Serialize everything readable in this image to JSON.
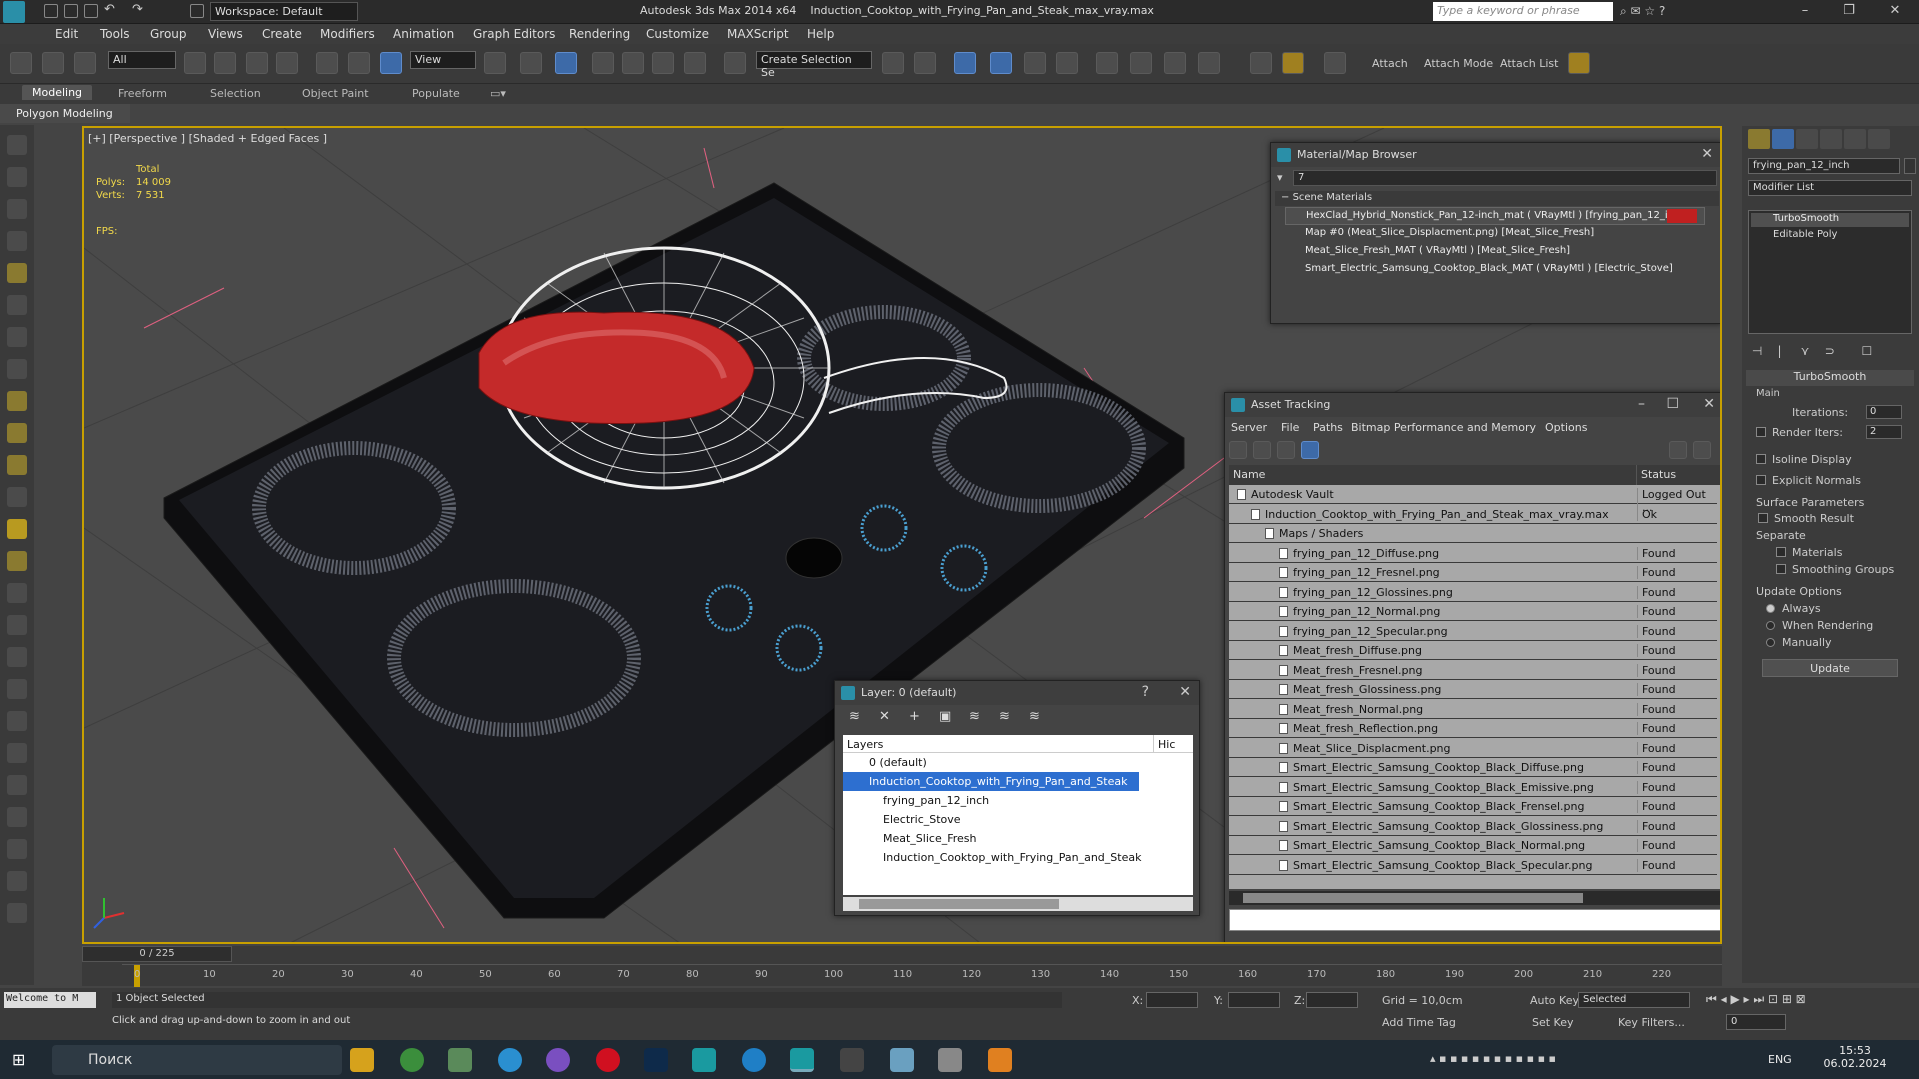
{
  "titlebar": {
    "workspace": "Workspace: Default",
    "app": "Autodesk 3ds Max  2014 x64",
    "file": "Induction_Cooktop_with_Frying_Pan_and_Steak_max_vray.max",
    "search_placeholder": "Type a keyword or phrase"
  },
  "menu": [
    "Edit",
    "Tools",
    "Group",
    "Views",
    "Create",
    "Modifiers",
    "Animation",
    "Graph Editors",
    "Rendering",
    "Customize",
    "MAXScript",
    "Help"
  ],
  "toolbar": {
    "filter": "All",
    "coord": "View",
    "selection_set": "Create Selection Se",
    "attach": "Attach",
    "attach_mode": "Attach Mode",
    "attach_list": "Attach List"
  },
  "ribbon": {
    "tabs": [
      "Modeling",
      "Freeform",
      "Selection",
      "Object Paint",
      "Populate"
    ],
    "sub": "Polygon Modeling"
  },
  "viewport": {
    "label": "[+] [Perspective ] [Shaded + Edged Faces ]",
    "total": "Total",
    "polys_label": "Polys:",
    "polys": "14 009",
    "verts_label": "Verts:",
    "verts": "7 531",
    "fps": "FPS:"
  },
  "material_browser": {
    "title": "Material/Map Browser",
    "filter": "7",
    "section": "Scene Materials",
    "items": [
      "HexClad_Hybrid_Nonstick_Pan_12-inch_mat ( VRayMtl ) [frying_pan_12_in...",
      "Map #0 (Meat_Slice_Displacment.png) [Meat_Slice_Fresh]",
      "Meat_Slice_Fresh_MAT ( VRayMtl ) [Meat_Slice_Fresh]",
      "Smart_Electric_Samsung_Cooktop_Black_MAT ( VRayMtl ) [Electric_Stove]"
    ]
  },
  "asset_tracking": {
    "title": "Asset Tracking",
    "menu": [
      "Server",
      "File",
      "Paths",
      "Bitmap Performance and Memory",
      "Options"
    ],
    "col_name": "Name",
    "col_status": "Status",
    "rows": [
      {
        "name": "Autodesk Vault",
        "status": "Logged Out ...",
        "indent": 0
      },
      {
        "name": "Induction_Cooktop_with_Frying_Pan_and_Steak_max_vray.max",
        "status": "Ok",
        "indent": 1
      },
      {
        "name": "Maps / Shaders",
        "status": "",
        "indent": 2
      },
      {
        "name": "frying_pan_12_Diffuse.png",
        "status": "Found",
        "indent": 3
      },
      {
        "name": "frying_pan_12_Fresnel.png",
        "status": "Found",
        "indent": 3
      },
      {
        "name": "frying_pan_12_Glossines.png",
        "status": "Found",
        "indent": 3
      },
      {
        "name": "frying_pan_12_Normal.png",
        "status": "Found",
        "indent": 3
      },
      {
        "name": "frying_pan_12_Specular.png",
        "status": "Found",
        "indent": 3
      },
      {
        "name": "Meat_fresh_Diffuse.png",
        "status": "Found",
        "indent": 3
      },
      {
        "name": "Meat_fresh_Fresnel.png",
        "status": "Found",
        "indent": 3
      },
      {
        "name": "Meat_fresh_Glossiness.png",
        "status": "Found",
        "indent": 3
      },
      {
        "name": "Meat_fresh_Normal.png",
        "status": "Found",
        "indent": 3
      },
      {
        "name": "Meat_fresh_Reflection.png",
        "status": "Found",
        "indent": 3
      },
      {
        "name": "Meat_Slice_Displacment.png",
        "status": "Found",
        "indent": 3
      },
      {
        "name": "Smart_Electric_Samsung_Cooktop_Black_Diffuse.png",
        "status": "Found",
        "indent": 3
      },
      {
        "name": "Smart_Electric_Samsung_Cooktop_Black_Emissive.png",
        "status": "Found",
        "indent": 3
      },
      {
        "name": "Smart_Electric_Samsung_Cooktop_Black_Frensel.png",
        "status": "Found",
        "indent": 3
      },
      {
        "name": "Smart_Electric_Samsung_Cooktop_Black_Glossiness.png",
        "status": "Found",
        "indent": 3
      },
      {
        "name": "Smart_Electric_Samsung_Cooktop_Black_Normal.png",
        "status": "Found",
        "indent": 3
      },
      {
        "name": "Smart_Electric_Samsung_Cooktop_Black_Specular.png",
        "status": "Found",
        "indent": 3
      }
    ]
  },
  "layer": {
    "title": "Layer: 0 (default)",
    "help": "?",
    "col_layers": "Layers",
    "col_hide": "Hic",
    "rows": [
      "0 (default)",
      "Induction_Cooktop_with_Frying_Pan_and_Steak",
      "frying_pan_12_inch",
      "Electric_Stove",
      "Meat_Slice_Fresh",
      "Induction_Cooktop_with_Frying_Pan_and_Steak"
    ]
  },
  "command_panel": {
    "object_name": "frying_pan_12_inch",
    "modifier_list": "Modifier List",
    "stack": [
      "TurboSmooth",
      "Editable Poly"
    ],
    "rollout": "TurboSmooth",
    "main": "Main",
    "iterations_label": "Iterations:",
    "iterations": "0",
    "render_iters_label": "Render Iters:",
    "render_iters": "2",
    "isoline": "Isoline Display",
    "explicit": "Explicit Normals",
    "surface": "Surface Parameters",
    "smooth_result": "Smooth Result",
    "separate": "Separate",
    "materials": "Materials",
    "smoothing_groups": "Smoothing Groups",
    "update_options": "Update Options",
    "always": "Always",
    "when_rendering": "When Rendering",
    "manually": "Manually",
    "update_btn": "Update"
  },
  "timeline": {
    "slider": "0 / 225",
    "ticks": [
      "0",
      "10",
      "20",
      "30",
      "40",
      "50",
      "60",
      "70",
      "80",
      "90",
      "100",
      "110",
      "120",
      "130",
      "140",
      "150",
      "160",
      "170",
      "180",
      "190",
      "200",
      "210",
      "220"
    ]
  },
  "status": {
    "maxscript": "Welcome to M",
    "selected": "1 Object Selected",
    "prompt": "Click and drag up-and-down to zoom in and out",
    "x": "X:",
    "y": "Y:",
    "z": "Z:",
    "grid": "Grid = 10,0cm",
    "add_time_tag": "Add Time Tag",
    "auto_key": "Auto Key",
    "set_key": "Set Key",
    "selected_dd": "Selected",
    "key_filters": "Key Filters...",
    "frame": "0"
  },
  "taskbar": {
    "search": "Поиск",
    "lang": "ENG",
    "time": "15:53",
    "date": "06.02.2024"
  },
  "colors": {
    "accent": "#3d6aa8",
    "viewport_border": "#c8a000",
    "stat": "#f2d94a"
  }
}
